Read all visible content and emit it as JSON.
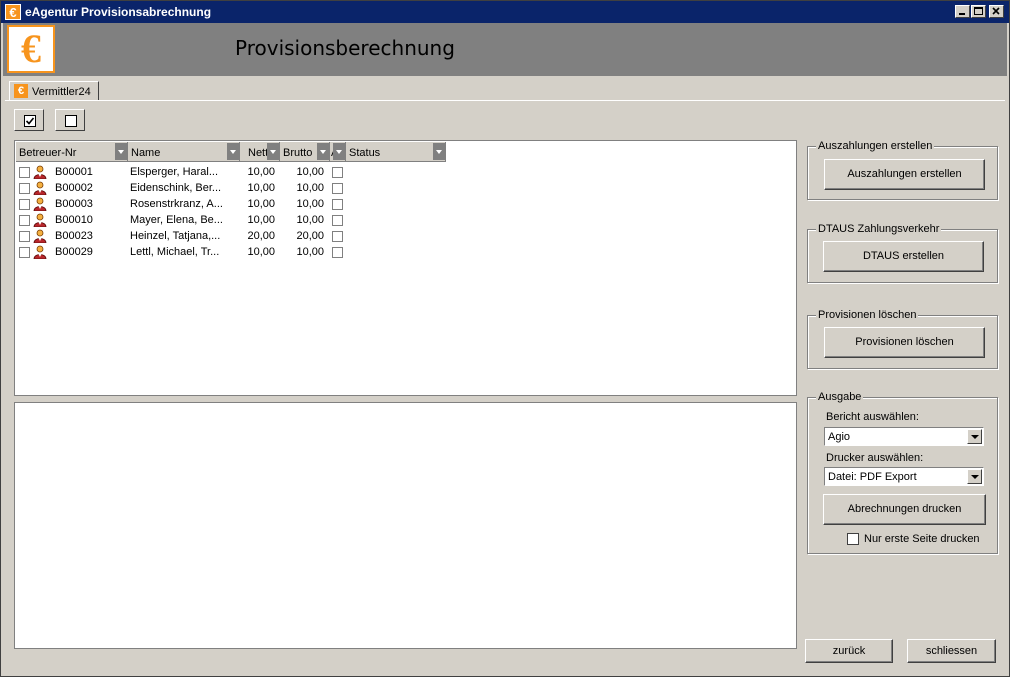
{
  "window": {
    "title": "eAgentur Provisionsabrechnung"
  },
  "header": {
    "logo_symbol": "€",
    "title": "Provisionsberechnung"
  },
  "tabs": [
    {
      "label": "Vermittler24",
      "icon": "euro-icon"
    }
  ],
  "grid": {
    "columns": [
      "Betreuer-Nr",
      "Name",
      "Netto",
      "Brutto",
      "A",
      "Status"
    ],
    "rows": [
      {
        "nr": "B00001",
        "name": "Elsperger, Haral...",
        "netto": "10,00",
        "brutto": "10,00"
      },
      {
        "nr": "B00002",
        "name": "Eidenschink, Ber...",
        "netto": "10,00",
        "brutto": "10,00"
      },
      {
        "nr": "B00003",
        "name": "Rosenstrkranz, A...",
        "netto": "10,00",
        "brutto": "10,00"
      },
      {
        "nr": "B00010",
        "name": "Mayer, Elena, Be...",
        "netto": "10,00",
        "brutto": "10,00"
      },
      {
        "nr": "B00023",
        "name": "Heinzel, Tatjana,...",
        "netto": "20,00",
        "brutto": "20,00"
      },
      {
        "nr": "B00029",
        "name": "Lettl, Michael, Tr...",
        "netto": "10,00",
        "brutto": "10,00"
      }
    ]
  },
  "panel": {
    "auszahlungen": {
      "title": "Auszahlungen erstellen",
      "button": "Auszahlungen erstellen"
    },
    "dtaus": {
      "title": "DTAUS Zahlungsverkehr",
      "button": "DTAUS erstellen"
    },
    "provisionen": {
      "title": "Provisionen löschen",
      "button": "Provisionen löschen"
    },
    "ausgabe": {
      "title": "Ausgabe",
      "bericht_label": "Bericht auswählen:",
      "bericht_value": "Agio",
      "drucker_label": "Drucker auswählen:",
      "drucker_value": "Datei: PDF Export",
      "print_button": "Abrechnungen drucken",
      "first_page_label": "Nur erste Seite drucken",
      "first_page_checked": false
    }
  },
  "footer": {
    "back_button": "zurück",
    "close_button": "schliessen"
  },
  "colors": {
    "titlebar": "#0a246a",
    "accent": "#f7941d",
    "header_bg": "#808080",
    "window_bg": "#d4d0c8"
  }
}
